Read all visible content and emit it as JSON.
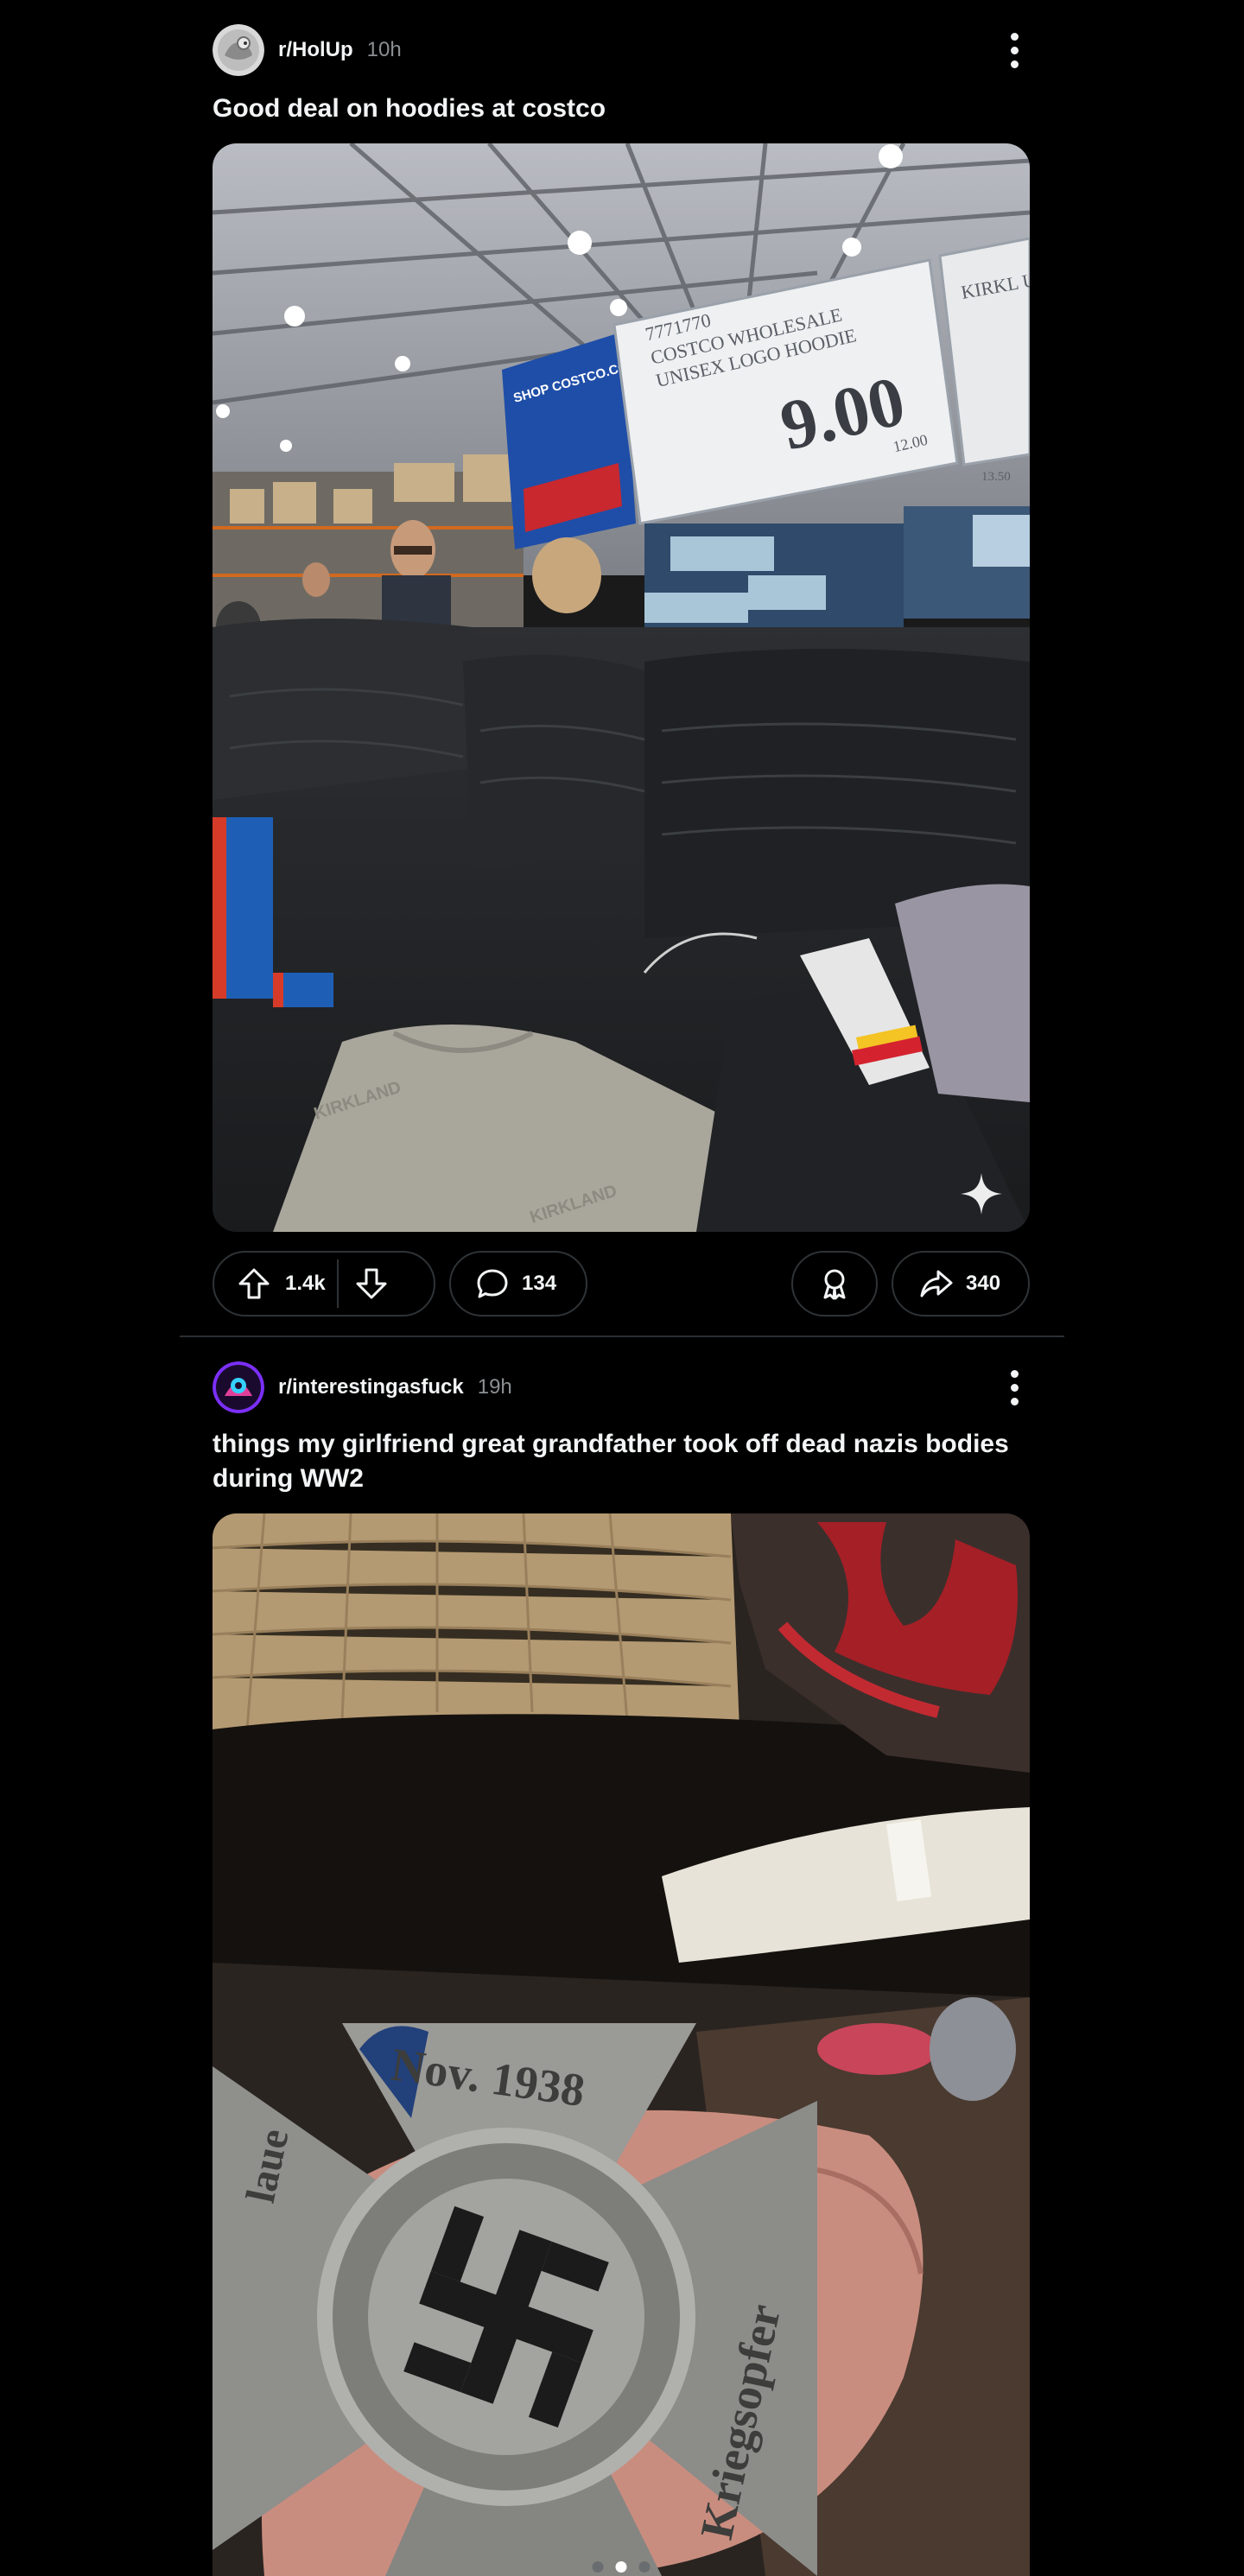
{
  "feed": {
    "posts": [
      {
        "subreddit": "r/HolUp",
        "age": "10h",
        "title": "Good deal on hoodies at costco",
        "media": {
          "sign_item_number": "7771770",
          "sign_line1": "COSTCO WHOLESALE",
          "sign_line2": "UNISEX LOGO HOODIE",
          "sign_price": "9.00",
          "sign_small_price": "12.00",
          "side_sign_text": "KIRKL UNISE",
          "side_sign_price": "13.50",
          "banner_text": "SHOP COSTCO.COM",
          "hoodie_print": "KIRKLAND"
        },
        "upvotes": "1.4k",
        "comments": "134",
        "shares": "340"
      },
      {
        "subreddit": "r/interestingasfuck",
        "age": "19h",
        "title": "things my girlfriend great grandfather took off dead nazis bodies during WW2",
        "media": {
          "medal_top_text": "Nov. 1938",
          "medal_right_text": "Kriegsopfer",
          "medal_left_text": "laue",
          "carousel_pages": 3,
          "carousel_active": 2
        }
      }
    ]
  },
  "icons": {
    "upvote": "arrow-up-outline-icon",
    "downvote": "arrow-down-outline-icon",
    "comment": "speech-bubble-icon",
    "award": "award-ribbon-icon",
    "share": "share-arrow-icon",
    "overflow": "vertical-dots-icon",
    "sparkle": "sparkle-icon"
  },
  "colors": {
    "background": "#000000",
    "text": "#f2f4f5",
    "muted": "#8b8f92",
    "pill_border": "#2f3336"
  }
}
